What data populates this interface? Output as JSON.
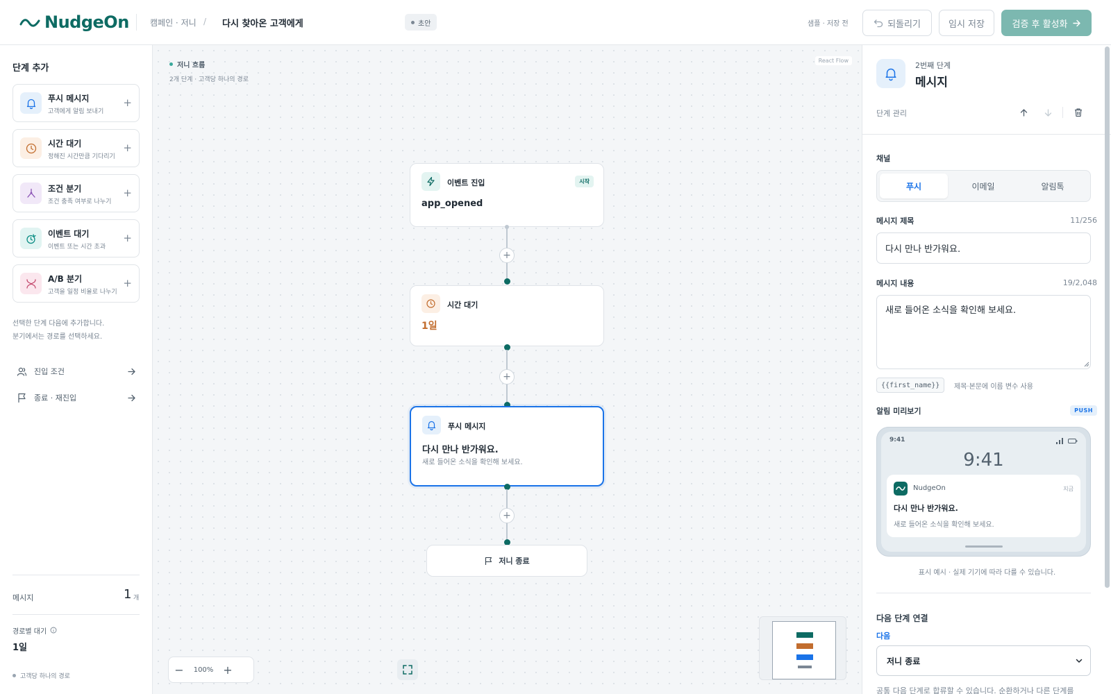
{
  "header": {
    "logo_text": "NudgeOn",
    "breadcrumb": "캠페인 · 저니",
    "breadcrumb_sep": "/",
    "page_title": "다시 찾아온 고객에게",
    "status_badge": "초안",
    "save_state": "샘플 · 저장 전",
    "undo_label": "되돌리기",
    "save_draft_label": "임시 저장",
    "activate_label": "검증 후 활성화"
  },
  "sidebar": {
    "title": "단계 추가",
    "steps": [
      {
        "label": "푸시 메시지",
        "desc": "고객에게 알림 보내기",
        "icon": "bell-icon",
        "color": "#1a73e8",
        "bg": "#e5f0fb"
      },
      {
        "label": "시간 대기",
        "desc": "정해진 시간만큼 기다리기",
        "icon": "clock-icon",
        "color": "#c26d2e",
        "bg": "#fcefe4"
      },
      {
        "label": "조건 분기",
        "desc": "조건 충족 여부로 나누기",
        "icon": "branch-icon",
        "color": "#8a52b5",
        "bg": "#f1e8f8"
      },
      {
        "label": "이벤트 대기",
        "desc": "이벤트 또는 시간 초과",
        "icon": "event-wait-icon",
        "color": "#0f8f86",
        "bg": "#e1f4f2"
      },
      {
        "label": "A/B 분기",
        "desc": "고객을 일정 비율로 나누기",
        "icon": "ab-split-icon",
        "color": "#c2456a",
        "bg": "#fbe7ee"
      }
    ],
    "hint_line1": "선택한 단계 다음에 추가합니다.",
    "hint_line2": "분기에서는 경로를 선택하세요.",
    "links": [
      {
        "label": "진입 조건",
        "icon": "users-icon"
      },
      {
        "label": "종료 · 재진입",
        "icon": "flag-icon"
      }
    ],
    "stats": {
      "message_label": "메시지",
      "message_count": "1",
      "message_unit": "개",
      "wait_label": "경로별 대기",
      "wait_value": "1일",
      "path_note": "고객당 하나의 경로"
    }
  },
  "canvas": {
    "title": "저니 흐름",
    "subtitle": "2개 단계 · 고객당 하나의 경로",
    "rf_label": "React Flow",
    "nodes": {
      "entry": {
        "label": "이벤트 진입",
        "tag": "시작",
        "value": "app_opened"
      },
      "wait": {
        "label": "시간 대기",
        "value": "1일"
      },
      "push": {
        "label": "푸시 메시지",
        "title": "다시 만나 반가워요.",
        "body": "새로 들어온 소식을 확인해 보세요."
      },
      "end": {
        "label": "저니 종료"
      }
    },
    "zoom": "100%",
    "colors": {
      "accent": "#0d6b63",
      "selected": "#1a73e8",
      "wait": "#c26d2e"
    }
  },
  "panel": {
    "step_num": "2번째 단계",
    "title": "메시지",
    "manage_label": "단계 관리",
    "channel_label": "채널",
    "channels": [
      "푸시",
      "이메일",
      "알림톡"
    ],
    "active_channel": "푸시",
    "msg_title_label": "메시지 제목",
    "msg_title_count": "11/256",
    "msg_title_value": "다시 만나 반가워요.",
    "msg_body_label": "메시지 내용",
    "msg_body_count": "19/2,048",
    "msg_body_value": "새로 들어온 소식을 확인해 보세요.",
    "var_chip": "{{first_name}}",
    "var_hint": "제목·본문에 이름 변수 사용",
    "preview_label": "알림 미리보기",
    "preview_tag": "PUSH",
    "phone": {
      "status_time": "9:41",
      "clock": "9:41",
      "app_name": "NudgeOn",
      "now": "지금",
      "notif_title": "다시 만나 반가워요.",
      "notif_body": "새로 들어온 소식을 확인해 보세요."
    },
    "preview_note": "표시 예시 · 실제 기기에 따라 다를 수 있습니다.",
    "next_label": "다음 단계 연결",
    "next_sub": "다음",
    "next_value": "저니 종료",
    "footer_text": "공통 다음 단계로 합류할 수 있습니다. 순환하거나 다른 단계를"
  }
}
